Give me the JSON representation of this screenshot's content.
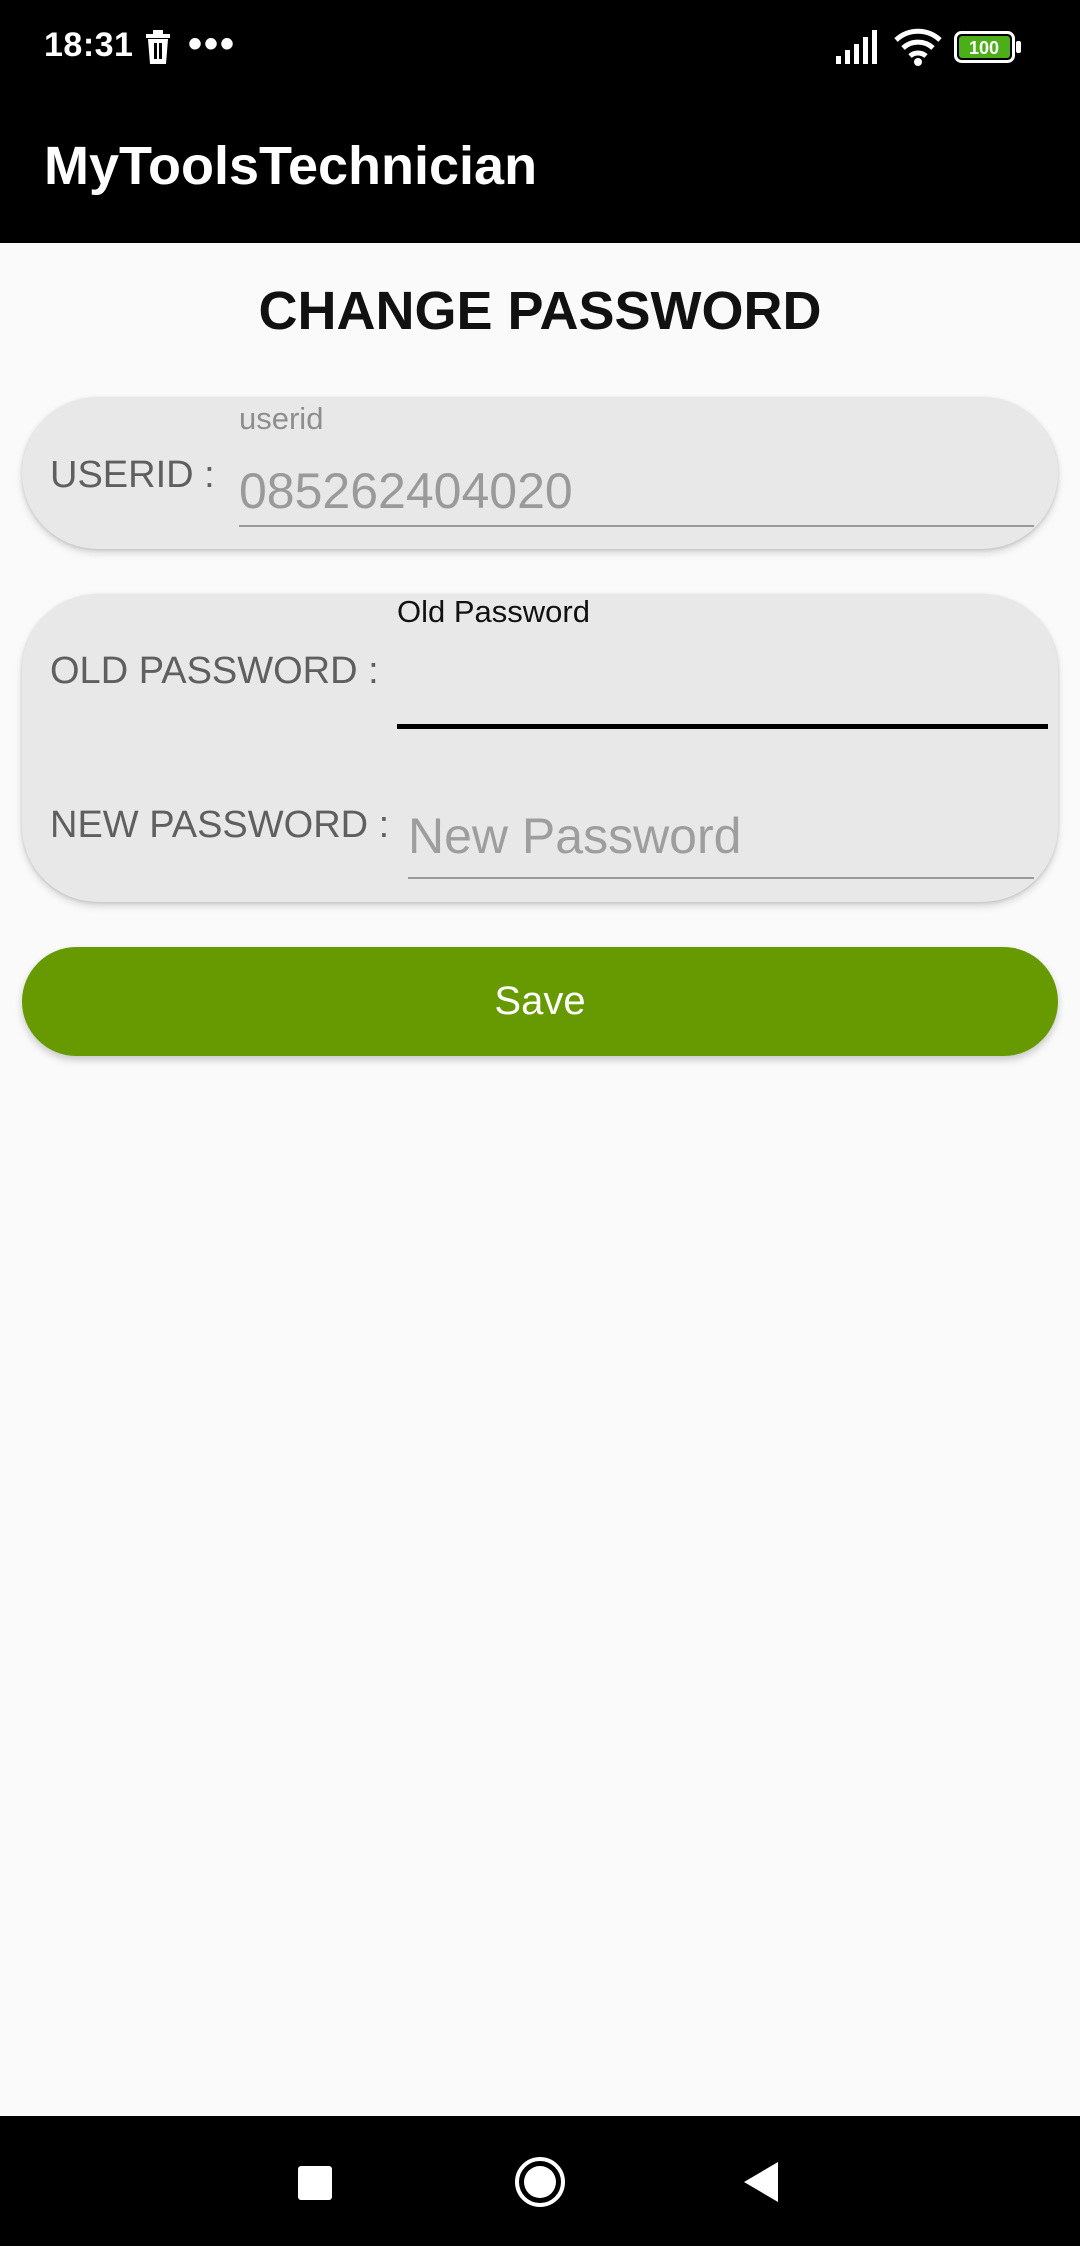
{
  "status_bar": {
    "time": "18:31",
    "dots": "•••",
    "battery_level": "100",
    "icons": [
      "trash-icon",
      "more-icon",
      "signal-icon",
      "wifi-icon",
      "battery-icon"
    ]
  },
  "app_bar": {
    "title": "MyToolsTechnician"
  },
  "page": {
    "title": "CHANGE PASSWORD"
  },
  "userid_card": {
    "label": "USERID :",
    "floating_label": "userid",
    "value": "085262404020"
  },
  "password_card": {
    "old_label": "OLD PASSWORD :",
    "old_floating_label": "Old Password",
    "old_value": "",
    "new_label": "NEW PASSWORD :",
    "new_placeholder": "New Password",
    "new_value": ""
  },
  "save_button": {
    "label": "Save",
    "color": "#679a00"
  },
  "nav_bar": {
    "icons": [
      "recents-icon",
      "home-icon",
      "back-icon"
    ]
  }
}
